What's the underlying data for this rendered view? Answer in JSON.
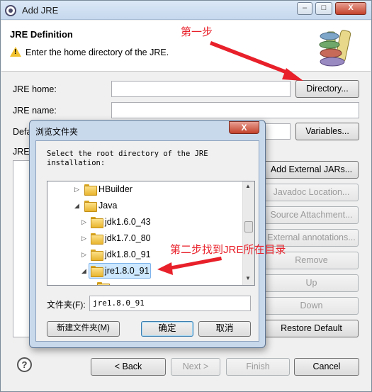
{
  "window": {
    "title": "Add JRE",
    "controls": {
      "minimize": "–",
      "restore": "□",
      "close": "X"
    }
  },
  "header": {
    "title": "JRE Definition",
    "message": "Enter the home directory of the JRE.",
    "icon": "library-books-icon"
  },
  "form": {
    "jre_home_label": "JRE home:",
    "jre_home_value": "",
    "jre_name_label": "JRE name:",
    "jre_name_value": "",
    "default_vm_label": "Defa",
    "jre_system_label": "JRE"
  },
  "side_buttons": {
    "directory": "Directory...",
    "variables": "Variables...",
    "add_external_jars": "Add External JARs...",
    "javadoc_location": "Javadoc Location...",
    "source_attachment": "Source Attachment...",
    "external_annotations": "External annotations...",
    "remove": "Remove",
    "up": "Up",
    "down": "Down",
    "restore_default": "Restore Default"
  },
  "footer": {
    "help_icon": "?",
    "back": "< Back",
    "next": "Next >",
    "finish": "Finish",
    "cancel": "Cancel"
  },
  "folder_dialog": {
    "title": "浏览文件夹",
    "close": "X",
    "prompt": "Select the root directory of the JRE installation:",
    "tree": [
      {
        "label": "HBuilder"
      },
      {
        "label": "Java"
      },
      {
        "label": "jdk1.6.0_43"
      },
      {
        "label": "jdk1.7.0_80"
      },
      {
        "label": "jdk1.8.0_91"
      },
      {
        "label": "jre1.8.0_91",
        "selected": true
      }
    ],
    "folder_label": "文件夹(F):",
    "folder_value": "jre1.8.0_91",
    "new_folder": "新建文件夹(M)",
    "ok": "确定",
    "cancel": "取消"
  },
  "annotations": {
    "step1": "第一步",
    "step2": "第二步找到JRE所在目录",
    "color": "#e8202a"
  }
}
